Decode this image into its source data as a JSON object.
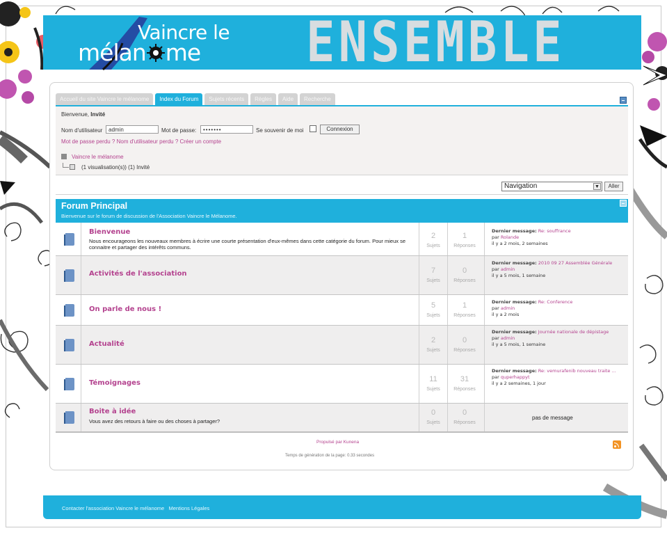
{
  "colors": {
    "accent": "#1fb0dc",
    "link": "#b4438f",
    "ensemble": "#d8dde0"
  },
  "header": {
    "logo_top": "Vaincre le",
    "logo_bottom_a": "mélan",
    "logo_bottom_b": "me",
    "banner_word": "ENSEMBLE"
  },
  "tabs": [
    "Accueil du site Vaincre le mélanome",
    "Index du Forum",
    "Sujets récents",
    "Règles",
    "Aide",
    "Recherche"
  ],
  "active_tab": "Index du Forum",
  "login": {
    "welcome_prefix": "Bienvenue,",
    "welcome_user": "Invité",
    "username_label": "Nom d'utilisateur",
    "username_value": "admin",
    "password_label": "Mot de passe:",
    "password_value": "•••••••",
    "remember_label": "Se souvenir de moi",
    "submit": "Connexion",
    "forgot": "Mot de passe perdu ? Nom d'utilisateur perdu ? Créer un compte"
  },
  "who": {
    "site": "Vaincre le mélanome",
    "viewers": "(1 visualisation(s)) (1) Invité"
  },
  "nav": {
    "select": "Navigation",
    "go": "Aller"
  },
  "category": {
    "title": "Forum Principal",
    "description": "Bienvenue sur le forum de discussion de l'Association Vaincre le Mélanome."
  },
  "forums": [
    {
      "name": "Bienvenue",
      "desc": "Nous encourageons les nouveaux membres à écrire une courte présentation d'eux-mêmes dans cette catégorie du forum. Pour mieux se connaitre et partager des intérêts communs.",
      "topics": "2",
      "replies": "1",
      "last": {
        "label": "Dernier message:",
        "subject": "Re: souffrance",
        "by": "par",
        "author": "Rolande",
        "ago": "il y a 2 mois, 2 semaines"
      }
    },
    {
      "name": "Activités de l'association",
      "desc": "",
      "topics": "7",
      "replies": "0",
      "last": {
        "label": "Dernier message:",
        "subject": "2010 09 27 Assemblée Générale",
        "by": "par",
        "author": "admin",
        "ago": "il y a 5 mois, 1 semaine"
      }
    },
    {
      "name": "On parle de nous !",
      "desc": "",
      "topics": "5",
      "replies": "1",
      "last": {
        "label": "Dernier message:",
        "subject": "Re: Conference",
        "by": "par",
        "author": "admin",
        "ago": "il y a 2 mois"
      }
    },
    {
      "name": "Actualité",
      "desc": "",
      "topics": "2",
      "replies": "0",
      "last": {
        "label": "Dernier message:",
        "subject": "Journée nationale de dépistage",
        "by": "par",
        "author": "admin",
        "ago": "il y a 5 mois, 1 semaine"
      }
    },
    {
      "name": "Témoignages",
      "desc": "",
      "topics": "11",
      "replies": "31",
      "last": {
        "label": "Dernier message:",
        "subject": "Re: vemurafenib nouveau traite ...",
        "by": "par",
        "author": "quperhappyt",
        "ago": "il y a 2 semaines, 1 jour"
      }
    },
    {
      "name": "Boite à idée",
      "desc": "Vous avez des retours à faire ou des choses à partager?",
      "topics": "0",
      "replies": "0",
      "no_message": "pas de message"
    }
  ],
  "labels": {
    "topics": "Sujets",
    "replies": "Réponses"
  },
  "footer": {
    "powered": "Propulsé par Kunena",
    "gentime": "Temps de génération de la page: 0.33 secondes",
    "link1": "Contacter l'association Vaincre le mélanome",
    "link2": "Mentions Légales"
  }
}
